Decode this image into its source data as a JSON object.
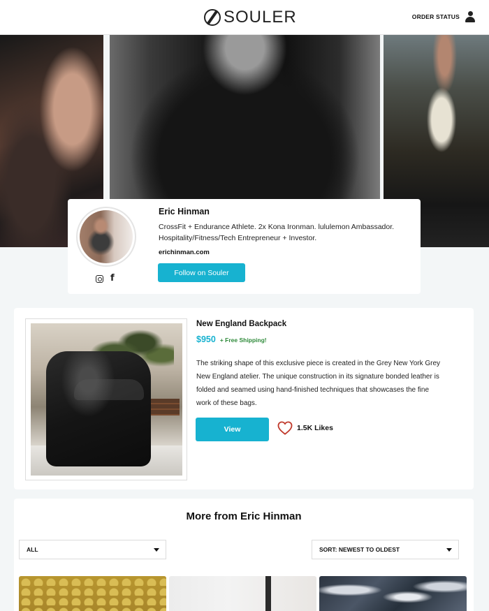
{
  "header": {
    "brand": "SOULER",
    "order_status": "ORDER STATUS",
    "icons": {
      "logo": "souler-logo-icon",
      "account": "user-icon"
    }
  },
  "profile": {
    "name": "Eric Hinman",
    "bio": "CrossFit + Endurance Athlete. 2x Kona Ironman. lululemon Ambassador. Hospitality/Fitness/Tech Entrepreneur + Investor.",
    "website": "erichinman.com",
    "follow_label": "Follow on Souler",
    "social_icons": [
      "instagram-icon",
      "facebook-icon"
    ]
  },
  "product": {
    "title": "New England Backpack",
    "price": "$950",
    "shipping": "+ Free Shipping!",
    "description": "The striking shape of this exclusive piece is created in the Grey New York Grey New England atelier. The unique construction in its signature bonded leather is folded and seamed using hand-finished techniques that showcases the fine work of these bags.",
    "view_label": "View",
    "likes_label": "1.5K Likes"
  },
  "more": {
    "title": "More from Eric Hinman",
    "filter_selected": "ALL",
    "sort_selected": "SORT: NEWEST TO OLDEST"
  },
  "colors": {
    "accent": "#17b2d0",
    "shipping_green": "#2e8a3a",
    "heart": "#c0392b",
    "page_background": "#f3f6f7"
  }
}
